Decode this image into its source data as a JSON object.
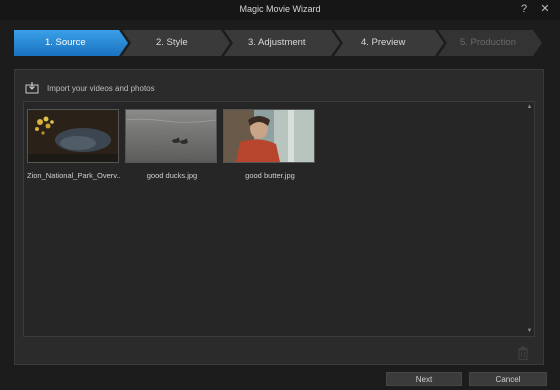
{
  "window": {
    "title": "Magic Movie Wizard",
    "help_label": "?",
    "close_label": "✕"
  },
  "steps": [
    {
      "label": "1. Source",
      "state": "active"
    },
    {
      "label": "2. Style",
      "state": "normal"
    },
    {
      "label": "3. Adjustment",
      "state": "normal"
    },
    {
      "label": "4. Preview",
      "state": "normal"
    },
    {
      "label": "5. Production",
      "state": "disabled"
    }
  ],
  "import": {
    "label": "Import your videos and photos",
    "icon": "import-icon"
  },
  "media": [
    {
      "caption": "Zion_National_Park_Overv...",
      "kind": "video"
    },
    {
      "caption": "good ducks.jpg",
      "kind": "photo"
    },
    {
      "caption": "good butter.jpg",
      "kind": "photo"
    }
  ],
  "scroll": {
    "up": "▲",
    "down": "▼"
  },
  "footer": {
    "next_label": "Next",
    "cancel_label": "Cancel"
  },
  "colors": {
    "accent": "#1f7fd0",
    "background": "#1c1c1c",
    "panel": "#2b2b2b"
  }
}
